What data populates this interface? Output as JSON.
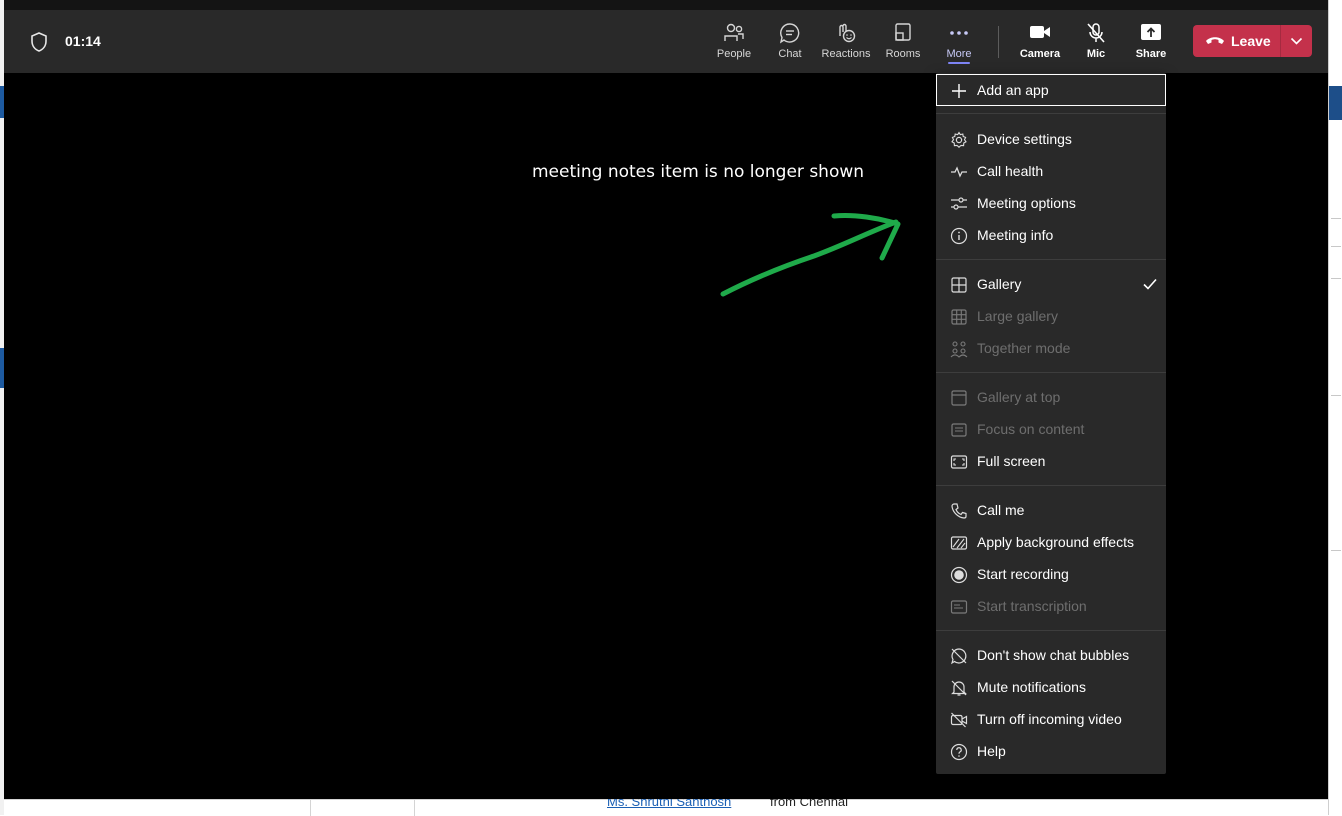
{
  "meeting": {
    "timer": "01:14"
  },
  "toolbar": {
    "people": "People",
    "chat": "Chat",
    "reactions": "Reactions",
    "rooms": "Rooms",
    "more": "More",
    "camera": "Camera",
    "mic": "Mic",
    "share": "Share",
    "leave": "Leave"
  },
  "annotation": {
    "text": "meeting notes item is no longer shown",
    "arrow_color": "#1faa4a"
  },
  "menu": {
    "add_app": "Add an app",
    "device_settings": "Device settings",
    "call_health": "Call health",
    "meeting_options": "Meeting options",
    "meeting_info": "Meeting info",
    "gallery": "Gallery",
    "large_gallery": "Large gallery",
    "together_mode": "Together mode",
    "gallery_at_top": "Gallery at top",
    "focus_on_content": "Focus on content",
    "full_screen": "Full screen",
    "call_me": "Call me",
    "apply_background_effects": "Apply background effects",
    "start_recording": "Start recording",
    "start_transcription": "Start transcription",
    "dont_show_chat_bubbles": "Don't show chat bubbles",
    "mute_notifications": "Mute notifications",
    "turn_off_incoming_video": "Turn off incoming video",
    "help": "Help"
  },
  "background": {
    "link_text": "Ms. Shruthi Santhosh",
    "after_text": "from Chennai"
  },
  "colors": {
    "leave_red": "#c4314b",
    "accent": "#7f85f5",
    "toolbar_bg": "#292929"
  }
}
